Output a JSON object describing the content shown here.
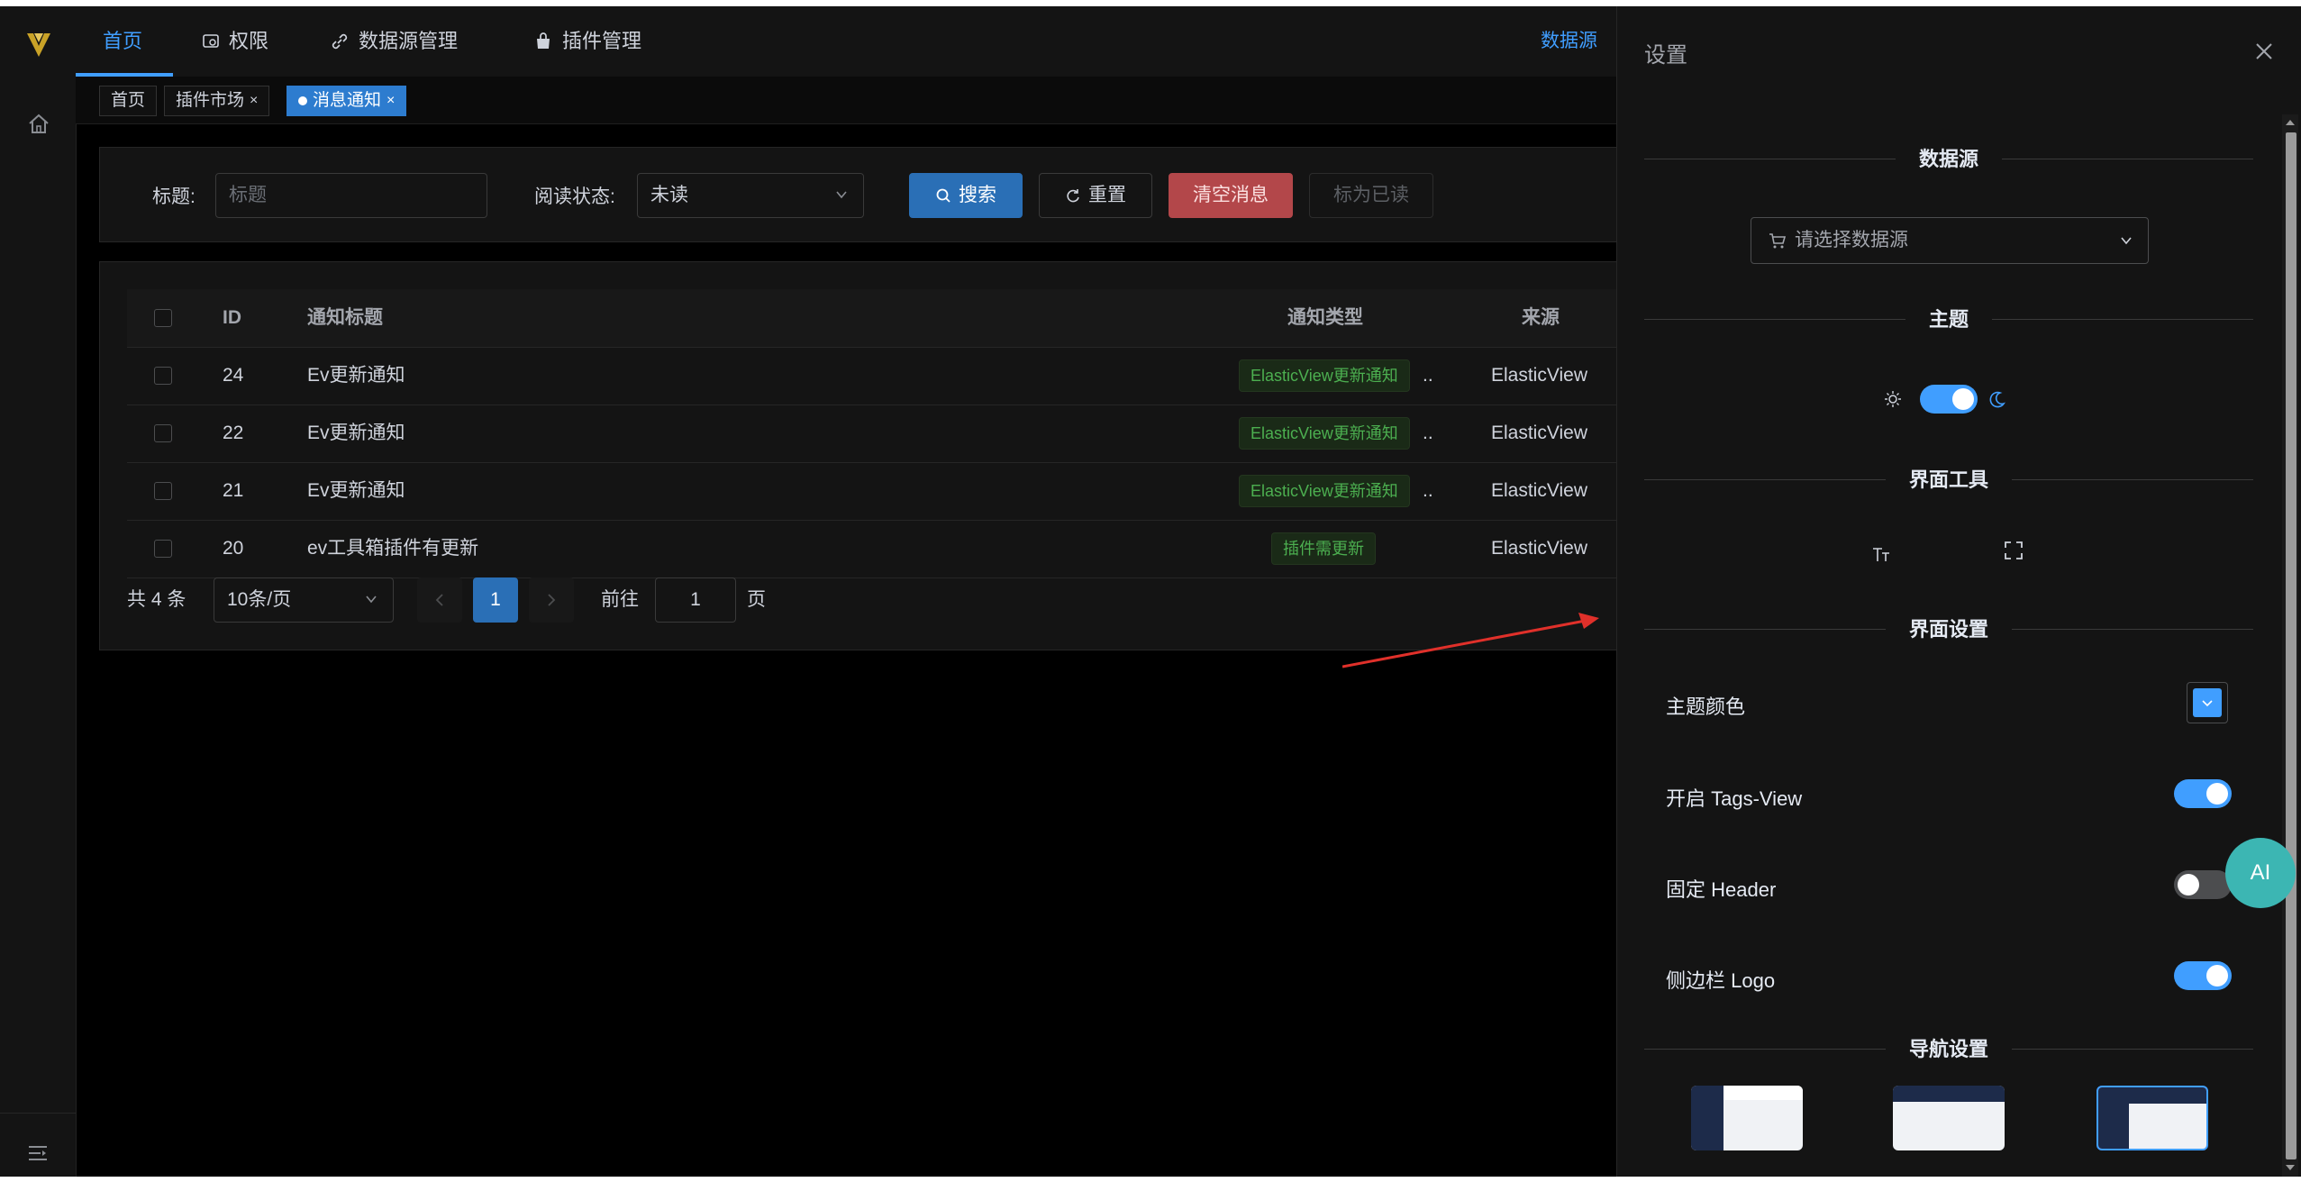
{
  "sidebar": {
    "logo": "logo-icon",
    "home": "home-icon",
    "collapse": "collapse-icon"
  },
  "topnav": {
    "items": [
      {
        "label": "首页",
        "icon": "home"
      },
      {
        "label": "权限",
        "icon": "shield-icon"
      },
      {
        "label": "数据源管理",
        "icon": "link-icon"
      },
      {
        "label": "插件管理",
        "icon": "bag-icon"
      }
    ],
    "datasource_label": "数据源"
  },
  "tags": [
    {
      "label": "首页"
    },
    {
      "label": "插件市场",
      "close": "×"
    },
    {
      "label": "消息通知",
      "close": "×"
    }
  ],
  "search": {
    "title_label": "标题:",
    "title_placeholder": "标题",
    "status_label": "阅读状态:",
    "status_value": "未读",
    "search_btn": "搜索",
    "reset_btn": "重置",
    "clear_btn": "清空消息",
    "mark_read_btn": "标为已读"
  },
  "table": {
    "headers": {
      "id": "ID",
      "title": "通知标题",
      "type": "通知类型",
      "source": "来源"
    },
    "rows": [
      {
        "id": "24",
        "title": "Ev更新通知",
        "type": "ElasticView更新通知",
        "ellipsis": "..",
        "source": "ElasticView"
      },
      {
        "id": "22",
        "title": "Ev更新通知",
        "type": "ElasticView更新通知",
        "ellipsis": "..",
        "source": "ElasticView"
      },
      {
        "id": "21",
        "title": "Ev更新通知",
        "type": "ElasticView更新通知",
        "ellipsis": "..",
        "source": "ElasticView"
      },
      {
        "id": "20",
        "title": "ev工具箱插件有更新",
        "type": "插件需更新",
        "ellipsis": "",
        "source": "ElasticView"
      }
    ]
  },
  "pagination": {
    "total": "共 4 条",
    "page_size": "10条/页",
    "current_page": "1",
    "goto_label": "前往",
    "goto_value": "1",
    "page_suffix": "页"
  },
  "drawer": {
    "title": "设置",
    "sections": {
      "datasource": "数据源",
      "theme": "主题",
      "ui_tools": "界面工具",
      "ui_settings": "界面设置",
      "nav_settings": "导航设置"
    },
    "datasource_placeholder": "请选择数据源",
    "theme_dark": true,
    "settings": {
      "theme_color_label": "主题颜色",
      "theme_color": "#409eff",
      "tags_view_label": "开启 Tags-View",
      "tags_view": true,
      "fixed_header_label": "固定 Header",
      "fixed_header": false,
      "sidebar_logo_label": "侧边栏 Logo",
      "sidebar_logo": true
    },
    "layouts": [
      {
        "name": "left",
        "selected": false
      },
      {
        "name": "top",
        "selected": false
      },
      {
        "name": "mix",
        "selected": true
      }
    ]
  },
  "ai_button": "AI",
  "colors": {
    "accent": "#409eff",
    "danger": "#b3474a",
    "success_text": "#4caf50"
  }
}
